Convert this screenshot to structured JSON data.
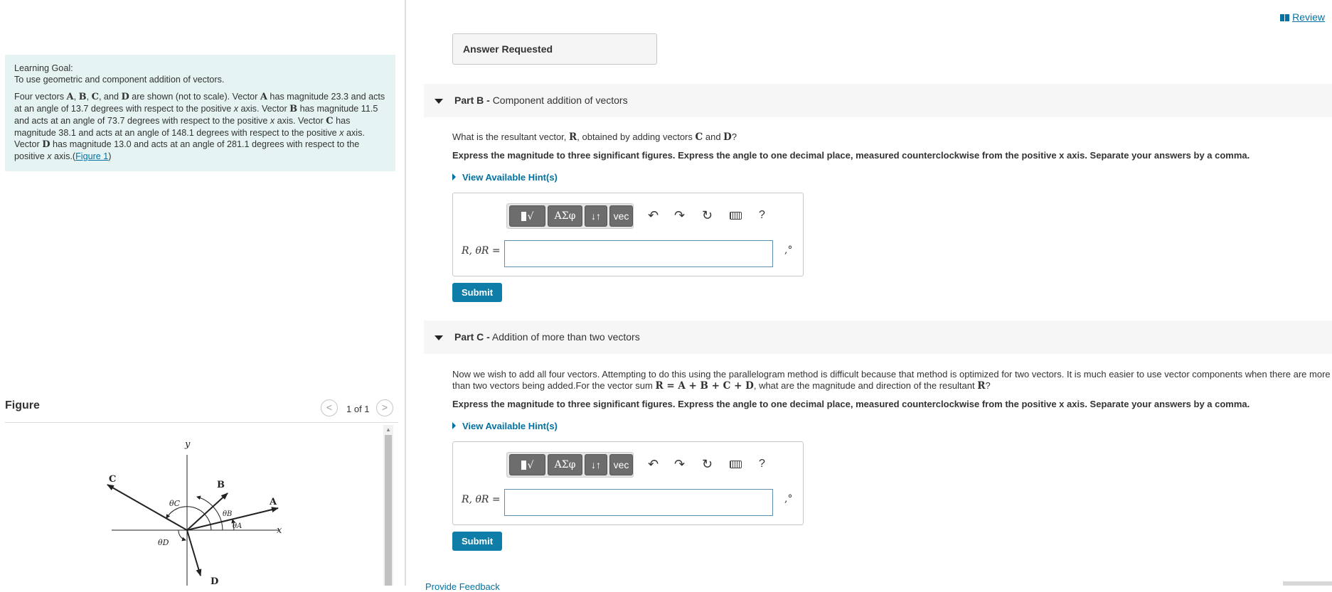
{
  "review_link": "Review",
  "learning_goal": {
    "title": "Learning Goal:",
    "text": "To use geometric and component addition of vectors.",
    "para_parts": [
      "Four vectors ",
      "A",
      ", ",
      "B",
      ", ",
      "C",
      ", and ",
      "D",
      " are shown (not to scale). Vector ",
      "A",
      " has magnitude 23.3 and acts at an angle of 13.7 degrees with respect to the positive ",
      "x",
      " axis. Vector ",
      "B",
      " has magnitude 11.5 and acts at an angle of 73.7 degrees with respect to the positive ",
      "x",
      " axis. Vector ",
      "C",
      " has magnitude 38.1 and acts at an angle of 148.1 degrees with respect to the positive ",
      "x",
      " axis. Vector ",
      "D",
      " has magnitude 13.0 and acts at an angle of 281.1 degrees with respect to the positive ",
      "x",
      " axis.("
    ],
    "figure_link": "Figure 1",
    "close_paren": ")"
  },
  "figure": {
    "title": "Figure",
    "pagination": "1 of 1",
    "prev_glyph": "<",
    "next_glyph": ">",
    "labels": {
      "y": "y",
      "x": "x",
      "A": "A",
      "B": "B",
      "C": "C",
      "D": "D",
      "thetaA": "θA",
      "thetaB": "θB",
      "thetaC": "θC",
      "thetaD": "θD"
    }
  },
  "answer_requested": "Answer Requested",
  "part_b": {
    "label": "Part B -",
    "title": "Component addition of vectors",
    "question_parts": [
      "What is the resultant vector, ",
      "R",
      ", obtained by adding vectors ",
      "C",
      " and ",
      "D",
      "?"
    ],
    "instruction": "Express the magnitude to three significant figures. Express the angle to one decimal place, measured counterclockwise from the positive x axis. Separate your answers by a comma.",
    "hint": "View Available Hint(s)",
    "eq_label": "R, θR =",
    "input_value": "",
    "unit": ",°",
    "submit": "Submit"
  },
  "part_c": {
    "label": "Part C -",
    "title": "Addition of more than two vectors",
    "question_line1": "Now we wish to add all four vectors. Attempting to do this using the parallelogram method is difficult because that method is optimized for two vectors. It is much easier to use vector components when there are more",
    "question_line2_parts": [
      "than two vectors being added.For the vector sum ",
      "R = A + B + C + D",
      ", what are the magnitude and direction of the resultant ",
      "R",
      "?"
    ],
    "instruction": "Express the magnitude to three significant figures. Express the angle to one decimal place, measured counterclockwise from the positive x axis. Separate your answers by a comma.",
    "hint": "View Available Hint(s)",
    "eq_label": "R, θR =",
    "input_value": "",
    "unit": ",°",
    "submit": "Submit"
  },
  "toolbar": {
    "templates": "√",
    "greek": "ΑΣφ",
    "updown": "↓↑",
    "vec": "vec",
    "undo": "↶",
    "redo": "↷",
    "reset": "↻",
    "help": "?"
  },
  "feedback_link": "Provide Feedback"
}
